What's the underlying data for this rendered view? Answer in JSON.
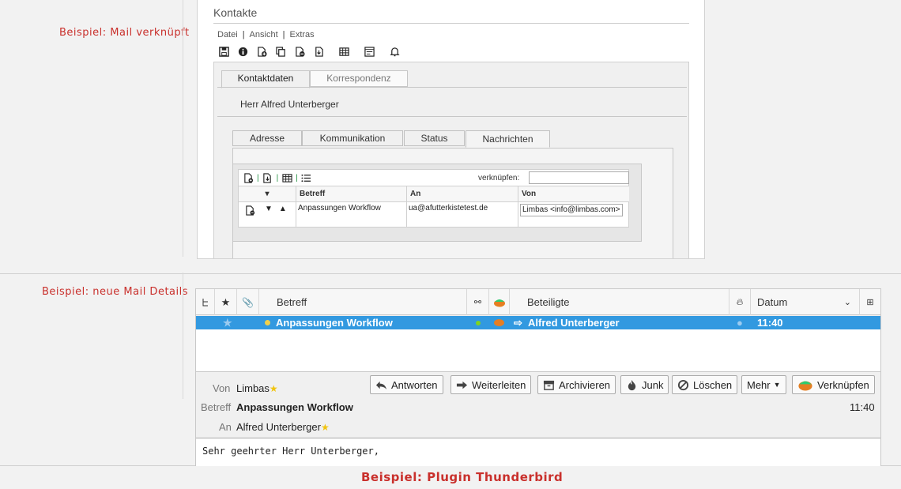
{
  "captions": {
    "linked": "Beispiel: Mail verknüpft",
    "details": "Beispiel: neue Mail Details",
    "plugin": "Beispiel: Plugin Thunderbird"
  },
  "limbas": {
    "title": "Kontakte",
    "menu": [
      "Datei",
      "Ansicht",
      "Extras"
    ],
    "toolbar_icons": [
      "save-icon",
      "info-icon",
      "new-record-icon",
      "copy-icon",
      "delete-record-icon",
      "export-icon",
      "table-icon",
      "form-icon",
      "bell-icon"
    ],
    "tabs": [
      "Kontaktdaten",
      "Korrespondenz"
    ],
    "person": "Herr Alfred Unterberger",
    "subtabs": [
      "Adresse",
      "Kommunikation",
      "Status",
      "Nachrichten"
    ],
    "messages": {
      "link_label": "verknüpfen:",
      "link_value": "",
      "columns": [
        "Betreff",
        "An",
        "Von"
      ],
      "rows": [
        {
          "betreff": "Anpassungen Workflow",
          "an": "ua@afutterkistetest.de",
          "von": "Limbas <info@limbas.com>"
        }
      ]
    }
  },
  "thunderbird": {
    "columns": {
      "subject": "Betreff",
      "participants": "Beteiligte",
      "date": "Datum"
    },
    "row": {
      "subject": "Anpassungen Workflow",
      "participant": "Alfred Unterberger",
      "date": "11:40"
    },
    "buttons": {
      "reply": "Antworten",
      "forward": "Weiterleiten",
      "archive": "Archivieren",
      "junk": "Junk",
      "delete": "Löschen",
      "more": "Mehr",
      "link": "Verknüpfen"
    },
    "header": {
      "from_label": "Von",
      "from_value": "Limbas",
      "subject_label": "Betreff",
      "subject_value": "Anpassungen Workflow",
      "time": "11:40",
      "to_label": "An",
      "to_value": "Alfred Unterberger"
    },
    "body": "Sehr geehrter Herr Unterberger,",
    "colors": {
      "selection": "#3299e0",
      "caption": "#c9302c"
    }
  }
}
